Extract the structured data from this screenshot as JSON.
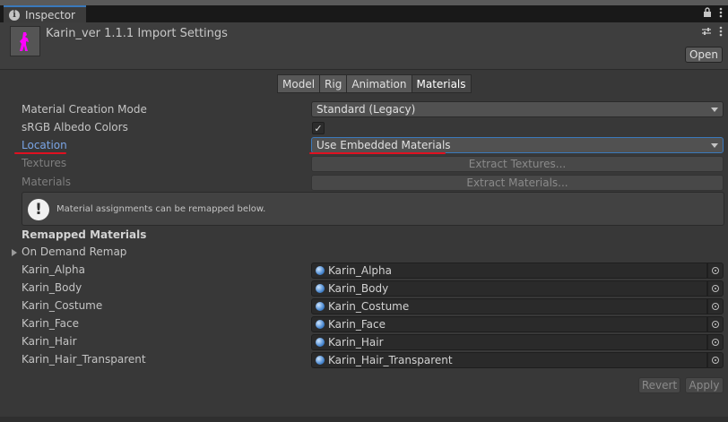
{
  "window": {
    "tab_title": "Inspector",
    "tab_icon": "info-icon",
    "actions": {
      "lock_icon": "lock-icon",
      "menu_icon": "kebab-menu-icon"
    }
  },
  "header": {
    "asset_title": "Karin_ver 1.1.1 Import Settings",
    "asset_icon": "model-asset-icon",
    "settings_icon": "sliders-icon",
    "menu_icon": "kebab-menu-icon",
    "open_label": "Open"
  },
  "tabs": [
    "Model",
    "Rig",
    "Animation",
    "Materials"
  ],
  "active_tab": "Materials",
  "settings": {
    "material_creation_mode": {
      "label": "Material Creation Mode",
      "value": "Standard (Legacy)"
    },
    "srgb": {
      "label": "sRGB Albedo Colors",
      "checked": true,
      "check_glyph": "✓"
    },
    "location": {
      "label": "Location",
      "value": "Use Embedded Materials"
    },
    "textures": {
      "label": "Textures",
      "button": "Extract Textures..."
    },
    "materials": {
      "label": "Materials",
      "button": "Extract Materials..."
    }
  },
  "help": {
    "icon": "warning-icon",
    "glyph": "!",
    "text": "Material assignments can be remapped below."
  },
  "remapped": {
    "title": "Remapped Materials",
    "foldout_label": "On Demand Remap",
    "rows": [
      {
        "name": "Karin_Alpha",
        "value": "Karin_Alpha"
      },
      {
        "name": "Karin_Body",
        "value": "Karin_Body"
      },
      {
        "name": "Karin_Costume",
        "value": "Karin_Costume"
      },
      {
        "name": "Karin_Face",
        "value": "Karin_Face"
      },
      {
        "name": "Karin_Hair",
        "value": "Karin_Hair"
      },
      {
        "name": "Karin_Hair_Transparent",
        "value": "Karin_Hair_Transparent"
      }
    ]
  },
  "footer": {
    "revert": "Revert",
    "apply": "Apply"
  },
  "colors": {
    "accent": "#3a79bb",
    "annotation": "#e01020",
    "link": "#7aa5e6",
    "asset_pink": "#ff00ff"
  }
}
